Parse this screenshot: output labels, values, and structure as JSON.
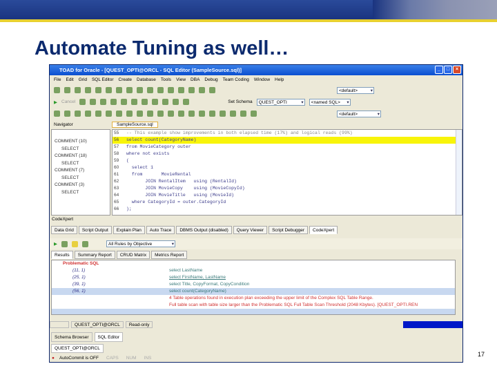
{
  "slide": {
    "title": "Automate Tuning as well…",
    "page_number": "17"
  },
  "window": {
    "title": "TOAD for Oracle - [QUEST_OPTI@ORCL - SQL Editor (SampleSource.sql)]",
    "menu": [
      "File",
      "Edit",
      "Grid",
      "SQL Editor",
      "Create",
      "Database",
      "Tools",
      "View",
      "DBA",
      "Debug",
      "Team Coding",
      "Window",
      "Help"
    ],
    "toolbar1": {
      "select": "<default>"
    },
    "toolbar2": {
      "cancel": "Cancel",
      "schema_label": "Set Schema",
      "schema": "QUEST_OPTI",
      "named_sql": "<named SQL>"
    },
    "toolbar3": {
      "select": "<default>"
    },
    "navigator_tab": "Navigator",
    "editor_tab": "SampleSource.sql"
  },
  "navigator": [
    "COMMENT  (10)",
    "SELECT",
    "COMMENT  (18)",
    "SELECT",
    "COMMENT  (7)",
    "SELECT",
    "COMMENT  (3)",
    "SELECT"
  ],
  "editor": {
    "lines": [
      {
        "n": "55",
        "t": "-- This example show improvements in both elapsed time (17%) and logical reads (99%)"
      },
      {
        "n": "56",
        "t": "select count(CategoryName)"
      },
      {
        "n": "57",
        "t": "from MovieCategory outer"
      },
      {
        "n": "58",
        "t": "where not exists"
      },
      {
        "n": "59",
        "t": "("
      },
      {
        "n": "60",
        "t": "  select 1"
      },
      {
        "n": "61",
        "t": "  from       MovieRental"
      },
      {
        "n": "62",
        "t": "       JOIN RentalItem   using (RentalId)"
      },
      {
        "n": "63",
        "t": "       JOIN MovieCopy    using (MovieCopyId)"
      },
      {
        "n": "64",
        "t": "       JOIN MovieTitle   using (MovieId)"
      },
      {
        "n": "65",
        "t": "  where CategoryId = outer.CategoryId"
      },
      {
        "n": "66",
        "t": ");"
      }
    ]
  },
  "codexpert": {
    "header": "CodeXpert",
    "tabs": [
      "Data Grid",
      "Script Output",
      "Explain Plan",
      "Auto Trace",
      "DBMS Output (disabled)",
      "Query Viewer",
      "Script Debugger",
      "CodeXpert"
    ],
    "rules": "All Rules by Objective",
    "subtabs": [
      "Results",
      "Summary Report",
      "CRUD Matrix",
      "Metrics Report"
    ],
    "group": "Problematic SQL",
    "rows": [
      {
        "pos": "(11, 1)",
        "sql": "select LastName"
      },
      {
        "pos": "(25, 1)",
        "sql": "select FirstName, LastName"
      },
      {
        "pos": "(39, 1)",
        "sql": "select Title, CopyFormat, CopyCondition"
      },
      {
        "pos": "(56, 1)",
        "sql": "select count(CategoryName)"
      }
    ],
    "messages": [
      "4 Table operations found in execution plan exceeding the upper limit of the Complex SQL Table Range.",
      "Full table scan with table size larger than the Problematic SQL Full Table Scan Threshold (2048 Kbytes). [QUEST_OPTI.REN"
    ]
  },
  "statusbar": {
    "connection": "QUEST_OPTI@ORCL",
    "mode": "Read-only"
  },
  "bottom_tabs": [
    "Schema Browser",
    "SQL Editor"
  ],
  "connection_tab": "QUEST_OPTI@ORCL",
  "footer": {
    "autocommit": "AutoCommit is OFF",
    "caps": "CAPS",
    "num": "NUM",
    "ins": "INS"
  }
}
